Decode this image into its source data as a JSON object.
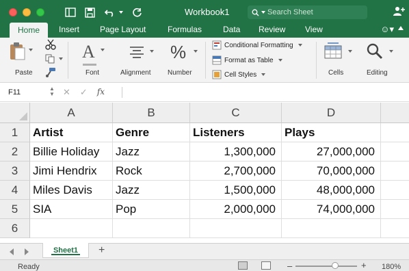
{
  "window": {
    "title": "Workbook1",
    "search_placeholder": "Search Sheet"
  },
  "tabs": [
    "Home",
    "Insert",
    "Page Layout",
    "Formulas",
    "Data",
    "Review",
    "View"
  ],
  "ribbon": {
    "paste": "Paste",
    "font": "Font",
    "alignment": "Alignment",
    "number": "Number",
    "conditional_formatting": "Conditional Formatting",
    "format_as_table": "Format as Table",
    "cell_styles": "Cell Styles",
    "cells": "Cells",
    "editing": "Editing"
  },
  "formula_bar": {
    "name_box": "F11",
    "fx": "fx",
    "value": ""
  },
  "grid": {
    "columns": [
      "A",
      "B",
      "C",
      "D"
    ],
    "rows": [
      "1",
      "2",
      "3",
      "4",
      "5",
      "6"
    ],
    "header_row": [
      "Artist",
      "Genre",
      "Listeners",
      "Plays"
    ],
    "data": [
      [
        "Billie Holiday",
        "Jazz",
        "1,300,000",
        "27,000,000"
      ],
      [
        "Jimi Hendrix",
        "Rock",
        "2,700,000",
        "70,000,000"
      ],
      [
        "Miles Davis",
        "Jazz",
        "1,500,000",
        "48,000,000"
      ],
      [
        "SIA",
        "Pop",
        "2,000,000",
        "74,000,000"
      ]
    ]
  },
  "sheet_tabs": {
    "active": "Sheet1",
    "add_label": "+"
  },
  "status_bar": {
    "status": "Ready",
    "zoom": "180%"
  },
  "colors": {
    "brand": "#217346",
    "ribbon_bg": "#f3f3f3",
    "header_bg": "#eeeeee"
  }
}
